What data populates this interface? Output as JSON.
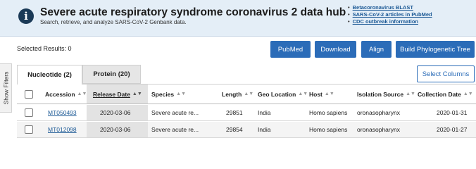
{
  "banner": {
    "icon": "info-icon",
    "title": "Severe acute respiratory syndrome coronavirus 2 data hub",
    "subtitle": "Search, retrieve, and analyze SARS-CoV-2 Genbank data.",
    "links": [
      "Betacoronavirus BLAST",
      "SARS-CoV-2 articles in PubMed",
      "CDC outbreak information"
    ]
  },
  "selected_results": "Selected Results: 0",
  "actions": {
    "pubmed": "PubMed",
    "download": "Download",
    "align": "Align",
    "phylo": "Build Phylogenetic Tree",
    "select_columns": "Select Columns"
  },
  "show_filters": "Show Filters",
  "tabs": [
    {
      "label": "Nucleotide (2)",
      "active": true
    },
    {
      "label": "Protein (20)",
      "active": false
    }
  ],
  "table": {
    "columns": [
      "Accession",
      "Release Date",
      "Species",
      "Length",
      "Geo Location",
      "Host",
      "Isolation Source",
      "Collection Date"
    ],
    "sorted_column": "Release Date",
    "sort_icon": "sort-arrows-icon",
    "rows": [
      {
        "accession": "MT050493",
        "release_date": "2020-03-06",
        "species": "Severe acute re...",
        "length": "29851",
        "geo_location": "India",
        "host": "Homo sapiens",
        "isolation_source": "oronasopharynx",
        "collection_date": "2020-01-31"
      },
      {
        "accession": "MT012098",
        "release_date": "2020-03-06",
        "species": "Severe acute re...",
        "length": "29854",
        "geo_location": "India",
        "host": "Homo sapiens",
        "isolation_source": "oronasopharynx",
        "collection_date": "2020-01-27"
      }
    ]
  },
  "colors": {
    "banner_bg": "#e4eef7",
    "primary_button": "#2b6cb8",
    "link": "#1d5a96"
  }
}
